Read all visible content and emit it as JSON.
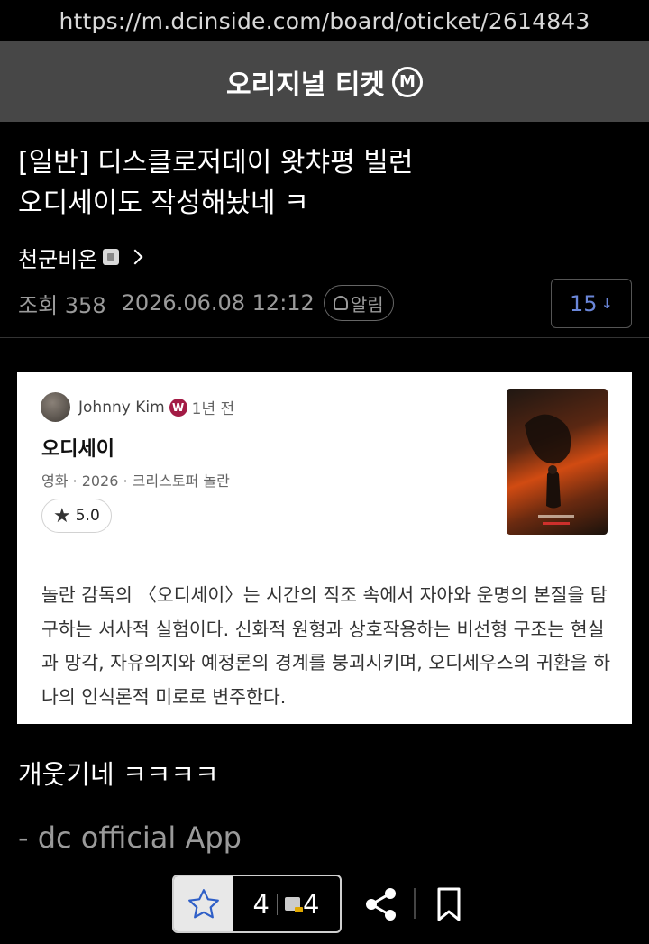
{
  "browser": {
    "url": "https://m.dcinside.com/board/oticket/2614843"
  },
  "board": {
    "title": "오리지널 티켓",
    "mark": "M"
  },
  "post": {
    "title": "[일반] 디스클로저데이 왓챠평 빌런 오디세이도 작성해놨네 ㅋ",
    "author": "천군비온",
    "views_label": "조회 358",
    "datetime": "2026.06.08 12:12",
    "alarm_label": "알림",
    "comment_count": "15",
    "comment_arrow": "↓",
    "body_text": "개웃기네 ㅋㅋㅋㅋ",
    "signature": "- dc official App"
  },
  "embed": {
    "username": "Johnny Kim",
    "badge": "W",
    "time": "1년 전",
    "movie_title": "오디세이",
    "movie_meta": "영화 · 2026 · 크리스토퍼 놀란",
    "rating": "5.0",
    "review": "놀란 감독의 〈오디세이〉는 시간의 직조 속에서 자아와 운명의 본질을 탐구하는 서사적 실험이다. 신화적 원형과 상호작용하는 비선형 구조는 현실과 망각, 자유의지와 예정론의 경계를 붕괴시키며, 오디세우스의 귀환을 하나의 인식론적 미로로 변주한다."
  },
  "actions": {
    "recommend_count": "4",
    "fixed_count": "4"
  },
  "icons": [
    "bell-icon",
    "star-icon",
    "share-icon",
    "bookmark-icon",
    "chevron-right-icon",
    "verified-badge-icon"
  ],
  "colors": {
    "header_bg": "#474747",
    "comment_count": "#6a86d8",
    "verified": "#a31b45"
  }
}
